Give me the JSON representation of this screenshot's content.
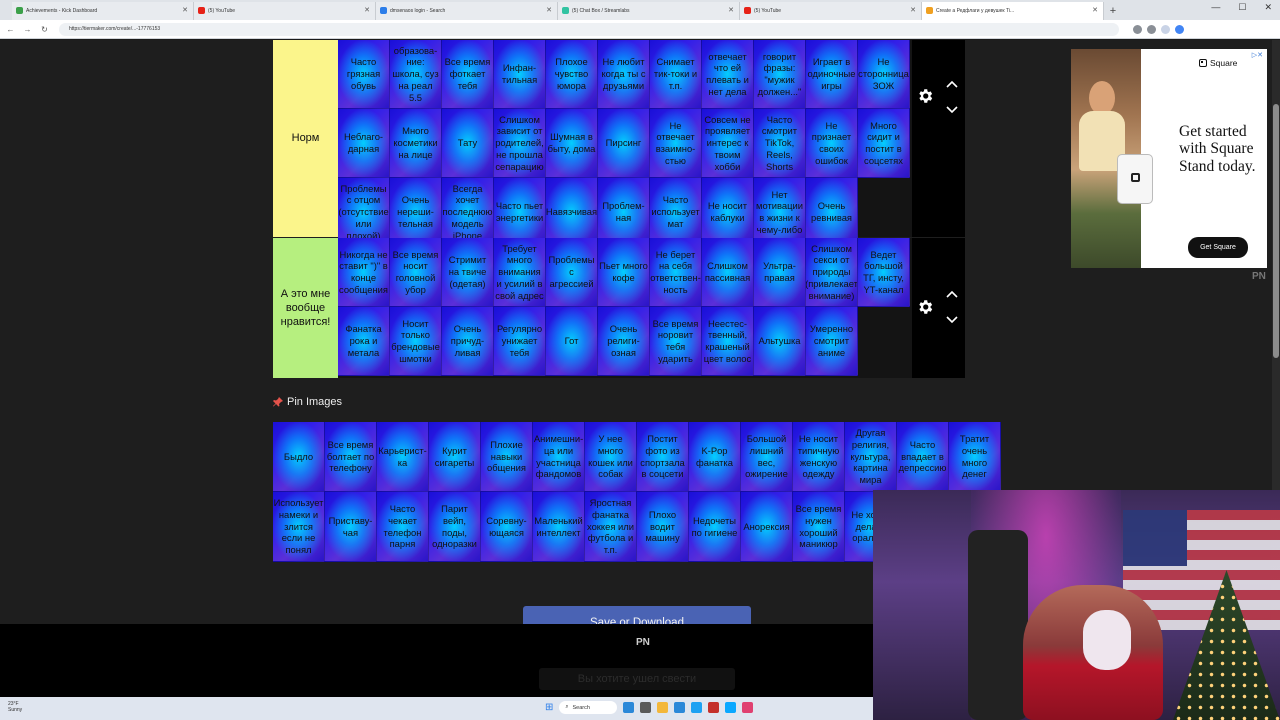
{
  "browser": {
    "tabs": [
      {
        "label": "Achievements - Kick Dashboard",
        "fav": "#3ca04a"
      },
      {
        "label": "(5) YouTube",
        "fav": "#e62117"
      },
      {
        "label": "dmsenaos login - Search",
        "fav": "#2b7de9"
      },
      {
        "label": "(5) Chat Box / Streamlabs",
        "fav": "#31c3a2"
      },
      {
        "label": "(5) YouTube",
        "fav": "#e62117"
      },
      {
        "label": "Create a Редфлаги у девушек Ti...",
        "fav": "#f0a020",
        "active": true
      }
    ],
    "new_tab": "+",
    "url": "https://tiermaker.com/create/...-17776153"
  },
  "tiers": [
    {
      "label": "Норм",
      "color": "#fbf58b",
      "items": [
        "Часто грязная обувь",
        "образова-ние: школа, суз на реал 5.5",
        "Все время фоткает тебя",
        "Инфан-тильная",
        "Плохое чувство юмора",
        "Не любит когда ты с друзьями",
        "Снимает тик-токи и т.п.",
        "отвечает что ей плевать и нет дела",
        "говорит фразы: \"мужик должен...\"",
        "Играет в одиночные игры",
        "Не сторонница ЗОЖ",
        "Неблаго-дарная",
        "Много косметики на лице",
        "Тату",
        "Слишком зависит от родителей, не прошла сепарацию",
        "Шумная в быту, дома",
        "Пирсинг",
        "Не отвечает взаимно-стью",
        "Совсем не проявляет интерес к твоим хобби",
        "Часто смотрит TikTok, Reels, Shorts",
        "Не признает своих ошибок",
        "Много сидит и постит в соцсетях",
        "Проблемы с отцом (отсутствие или плохой)",
        "Очень нереши-тельная",
        "Всегда хочет последнюю модель iPhone",
        "Часто пьет энергетики",
        "Навязчивая",
        "Проблем-ная",
        "Часто использует мат",
        "Не носит каблуки",
        "Нет мотивации в жизни к чему-либо",
        "Очень ревнивая"
      ]
    },
    {
      "label": "А это мне вообще нравится!",
      "color": "#b6ef7f",
      "items": [
        "Никогда не ставит \")\" в конце сообщения",
        "Все время носит головной убор",
        "Стримит на твиче (одетая)",
        "Требует много внимания и усилий в свой адрес",
        "Проблемы с агрессией",
        "Пьет много кофе",
        "Не берет на себя ответствен-ность",
        "Слишком пассивная",
        "Ультра-правая",
        "Слишком секси от природы (привлекает внимание)",
        "Ведет большой ТГ, инсту, YT-канал",
        "Фанатка рока и метала",
        "Носит только брендовые шмотки",
        "Очень причуд-ливая",
        "Регулярно унижает тебя",
        "Гот",
        "Очень религи-озная",
        "Все время норовит тебя ударить",
        "Неестес-твенный, крашеный цвет волос",
        "Альтушка",
        "Умеренно смотрит аниме"
      ]
    }
  ],
  "pin": {
    "title": "Pin Images",
    "items": [
      "Быдло",
      "Все время болтает по телефону",
      "Карьерист-ка",
      "Курит сигареты",
      "Плохие навыки общения",
      "Анимешни-ца или участница фандомов",
      "У нее много кошек или собак",
      "Постит фото из спортзала в соцсети",
      "K-Pop фанатка",
      "Большой лишний вес, ожирение",
      "Не носит типичную женскую одежду",
      "Другая религия, культура, картина мира",
      "Часто впадает в депрессию",
      "Тратит очень много денег",
      "Использует намеки и злится если не понял",
      "Приставу-чая",
      "Часто чекает телефон парня",
      "Парит вейп, поды, одноразки",
      "Соревну-ющаяся",
      "Маленький интеллект",
      "Яростная фанатка хоккея или футбола и т.п.",
      "Плохо водит машину",
      "Недочеты по гигиене",
      "Анорексия",
      "Все время нужен хороший маникюр",
      "Не хочет делать орально"
    ]
  },
  "save_button": "Save or Download",
  "overlay_logo": "PN",
  "ghost_button": "Вы хотите ушел свести",
  "ad": {
    "brand": "Square",
    "headline": "Get started with Square Stand today.",
    "cta": "Get Square",
    "info_icon": "info-icon"
  },
  "right_logo": "PN",
  "taskbar": {
    "weather_temp": "23°F",
    "weather_desc": "Sunny",
    "search_placeholder": "Search",
    "icons": [
      "#2b88d8",
      "#5a5a5a",
      "#f3b73b",
      "#2b88d8",
      "#1da1f2",
      "#c4302b",
      "#0aa8ff",
      "#e04070"
    ]
  }
}
